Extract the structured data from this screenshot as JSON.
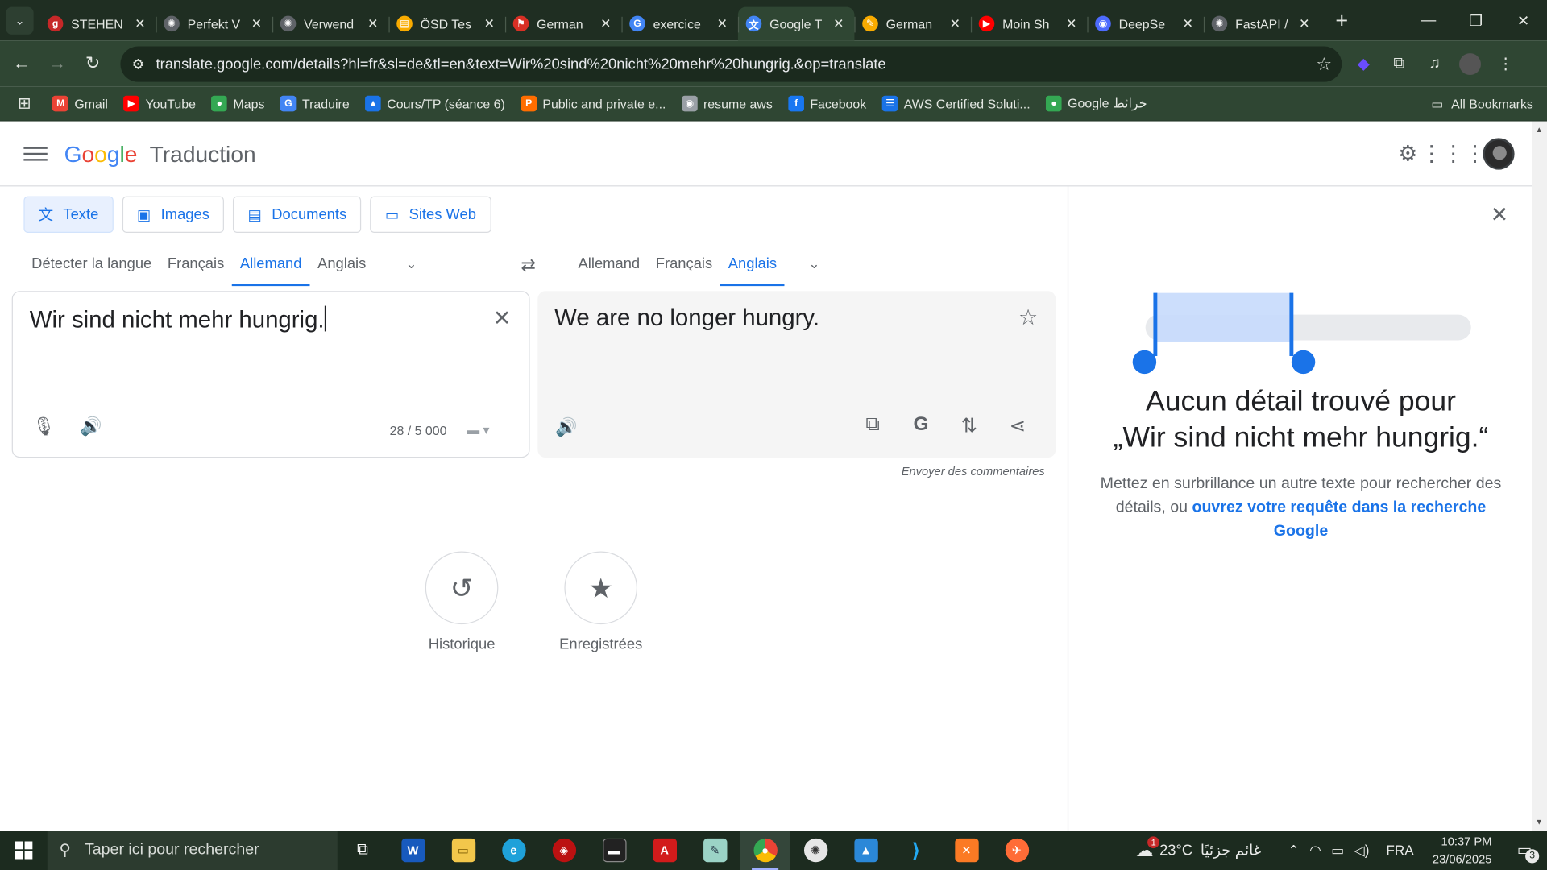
{
  "browser": {
    "tabs": [
      {
        "title": "STEHEN",
        "favicon_color": "#c62828",
        "favicon_glyph": "g"
      },
      {
        "title": "Perfekt V",
        "favicon_color": "#5f6368",
        "favicon_glyph": "openai-icon"
      },
      {
        "title": "Verwend",
        "favicon_color": "#5f6368",
        "favicon_glyph": "openai-icon"
      },
      {
        "title": "ÖSD Tes",
        "favicon_color": "#f9ab00",
        "favicon_glyph": "doc-icon"
      },
      {
        "title": "German",
        "favicon_color": "#d93025",
        "favicon_glyph": "bookmark-icon"
      },
      {
        "title": "exercice",
        "favicon_color": "#4285f4",
        "favicon_glyph": "G"
      },
      {
        "title": "Google T",
        "favicon_color": "#4285f4",
        "favicon_glyph": "translate-icon",
        "active": true
      },
      {
        "title": "German",
        "favicon_color": "#f9ab00",
        "favicon_glyph": "pencil-icon"
      },
      {
        "title": "Moin Sh",
        "favicon_color": "#ff0000",
        "favicon_glyph": "youtube-icon"
      },
      {
        "title": "DeepSe",
        "favicon_color": "#4d6bfe",
        "favicon_glyph": "deepseek-icon"
      },
      {
        "title": "FastAPI /",
        "favicon_color": "#5f6368",
        "favicon_glyph": "openai-icon"
      }
    ],
    "url": "translate.google.com/details?hl=fr&sl=de&tl=en&text=Wir%20sind%20nicht%20mehr%20hungrig.&op=translate",
    "bookmarks": [
      {
        "label": "Gmail",
        "color": "#ea4335",
        "glyph": "M"
      },
      {
        "label": "YouTube",
        "color": "#ff0000",
        "glyph": "▶"
      },
      {
        "label": "Maps",
        "color": "#34a853",
        "glyph": "●"
      },
      {
        "label": "Traduire",
        "color": "#4285f4",
        "glyph": "G"
      },
      {
        "label": "Cours/TP (séance 6)",
        "color": "#1a73e8",
        "glyph": "▲"
      },
      {
        "label": "Public and private e...",
        "color": "#ff6d00",
        "glyph": "P"
      },
      {
        "label": "resume aws",
        "color": "#9aa0a6",
        "glyph": "◉"
      },
      {
        "label": "Facebook",
        "color": "#1877f2",
        "glyph": "f"
      },
      {
        "label": "AWS Certified Soluti...",
        "color": "#1a73e8",
        "glyph": "☰"
      },
      {
        "label": "Google خرائط",
        "color": "#34a853",
        "glyph": "●"
      }
    ],
    "all_bookmarks": "All Bookmarks"
  },
  "header": {
    "logo_letters": [
      "G",
      "o",
      "o",
      "g",
      "l",
      "e"
    ],
    "product": "Traduction"
  },
  "modes": [
    {
      "label": "Texte",
      "icon": "translate-icon",
      "active": true
    },
    {
      "label": "Images",
      "icon": "image-icon"
    },
    {
      "label": "Documents",
      "icon": "document-icon"
    },
    {
      "label": "Sites Web",
      "icon": "website-icon"
    }
  ],
  "source_langs": [
    {
      "label": "Détecter la langue"
    },
    {
      "label": "Français"
    },
    {
      "label": "Allemand",
      "active": true
    },
    {
      "label": "Anglais"
    }
  ],
  "target_langs": [
    {
      "label": "Allemand"
    },
    {
      "label": "Français"
    },
    {
      "label": "Anglais",
      "active": true
    }
  ],
  "source": {
    "text": "Wir sind nicht mehr hungrig.",
    "char_count": "28 / 5 000"
  },
  "target": {
    "text": "We are no longer hungry."
  },
  "feedback": "Envoyer des commentaires",
  "history": [
    {
      "label": "Historique",
      "icon": "history-icon"
    },
    {
      "label": "Enregistrées",
      "icon": "star-icon"
    }
  ],
  "side_panel": {
    "title_line1": "Aucun détail trouvé pour",
    "title_line2": "„Wir sind nicht mehr hungrig.“",
    "desc_prefix": "Mettez en surbrillance un autre texte pour rechercher des détails, ou ",
    "desc_link": "ouvrez votre requête dans la recherche Google"
  },
  "taskbar": {
    "search_placeholder": "Taper ici pour rechercher",
    "weather_temp": "23°C",
    "weather_text": "غائم جزئيًا",
    "weather_badge": "1",
    "lang": "FRA",
    "time": "10:37 PM",
    "date": "23/06/2025",
    "notification_count": "3"
  }
}
